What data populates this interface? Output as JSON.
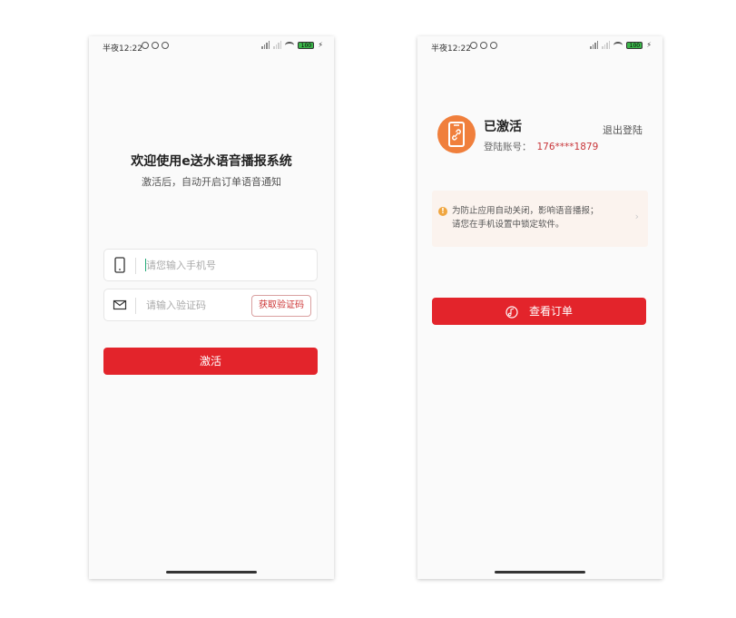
{
  "login": {
    "status_bar": {
      "time": "半夜12:22",
      "battery": "100"
    },
    "title": "欢迎使用e送水语音播报系统",
    "subtitle": "激活后，自动开启订单语音通知",
    "phone_placeholder": "请您输入手机号",
    "code_placeholder": "请输入验证码",
    "get_code_label": "获取验证码",
    "activate_label": "激活",
    "icons": [
      "phone-icon",
      "mail-icon"
    ]
  },
  "activated": {
    "status_bar": {
      "time": "半夜12:22",
      "battery": "100"
    },
    "status_title": "已激活",
    "account_label": "登陆账号：",
    "account_value": "176****1879",
    "logout_label": "退出登陆",
    "notice_line1": "为防止应用自动关闭，影响语音播报；",
    "notice_line2": "请您在手机设置中锁定软件。",
    "view_orders_label": "查看订单",
    "icons": [
      "phone-link-icon",
      "info-icon",
      "chevron-right-icon",
      "music-icon"
    ]
  },
  "colors": {
    "primary": "#e3242b",
    "avatar": "#f07f3c",
    "notice_bg": "#fbf3ee",
    "account": "#c8363a"
  }
}
